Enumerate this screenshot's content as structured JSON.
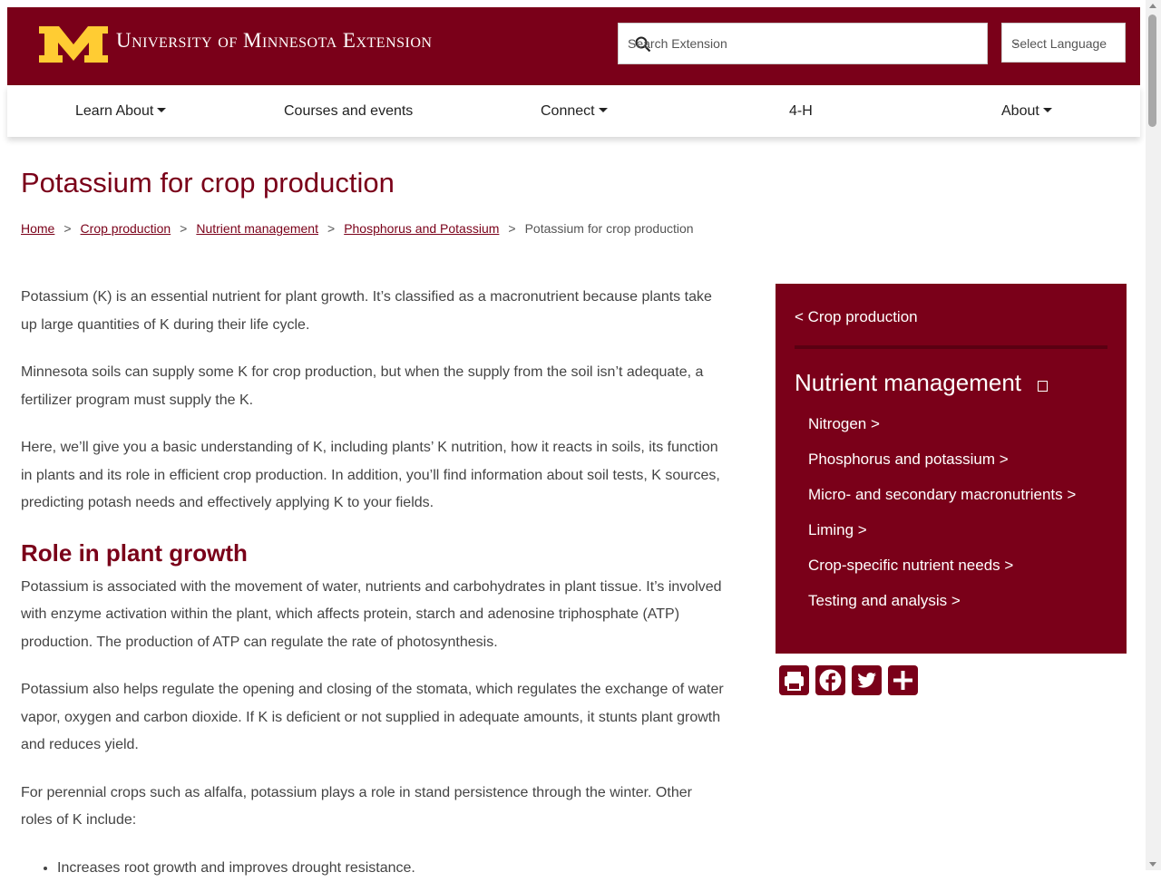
{
  "header": {
    "brand": "University of Minnesota Extension",
    "search_placeholder": "Search Extension",
    "language_label": "Select Language",
    "brand_color": "#7a0019",
    "logo_color": "#ffcc33"
  },
  "nav": {
    "items": [
      {
        "label": "Learn About",
        "dropdown": true
      },
      {
        "label": "Courses and events",
        "dropdown": false
      },
      {
        "label": "Connect",
        "dropdown": true
      },
      {
        "label": "4-H",
        "dropdown": false
      },
      {
        "label": "About",
        "dropdown": true
      }
    ]
  },
  "page": {
    "title": "Potassium for crop production"
  },
  "breadcrumb": {
    "items": [
      "Home",
      "Crop production",
      "Nutrient management",
      "Phosphorus and Potassium"
    ],
    "current": "Potassium for crop production",
    "separator": ">"
  },
  "content": {
    "intro": [
      "Potassium (K) is an essential nutrient for plant growth. It’s classified as a macronutrient because plants take up large quantities of K during their life cycle.",
      "Minnesota soils can supply some K for crop production, but when the supply from the soil isn’t adequate, a fertilizer program must supply the K.",
      "Here, we’ll give you a basic understanding of K, including plants’ K nutrition, how it reacts in soils, its function in plants and its role in efficient crop production. In addition, you’ll find information about soil tests, K sources, predicting potash needs and effectively applying K to your fields."
    ],
    "section_heading": "Role in plant growth",
    "section_paragraphs": [
      "Potassium is associated with the movement of water, nutrients and carbohydrates in plant tissue. It’s involved with enzyme activation within the plant, which affects protein, starch and adenosine triphosphate (ATP) production. The production of ATP can regulate the rate of photosynthesis.",
      "Potassium also helps regulate the opening and closing of the stomata, which regulates the exchange of water vapor, oxygen and carbon dioxide. If K is deficient or not supplied in adequate amounts, it stunts plant growth and reduces yield.",
      "For perennial crops such as alfalfa, potassium plays a role in stand persistence through the winter. Other roles of K include:"
    ],
    "list": [
      "Increases root growth and improves drought resistance."
    ]
  },
  "sidebar": {
    "back_link": "< Crop production",
    "heading": "Nutrient management",
    "links": [
      "Nitrogen >",
      "Phosphorus and potassium >",
      "Micro- and secondary macronutrients >",
      "Liming >",
      "Crop-specific nutrient needs >",
      "Testing and analysis >"
    ]
  },
  "share": {
    "icons": [
      "print-icon",
      "facebook-icon",
      "twitter-icon",
      "plus-icon"
    ]
  }
}
